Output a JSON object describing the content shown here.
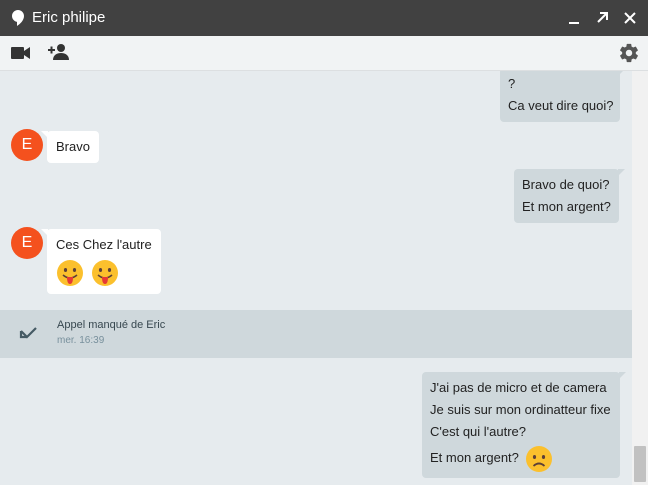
{
  "window": {
    "title": "Eric philipe",
    "icons": [
      "hangouts-bubble-icon",
      "minimize-icon",
      "popout-icon",
      "close-icon"
    ]
  },
  "toolbar": {
    "icons": [
      "video-call-icon",
      "add-person-icon",
      "settings-gear-icon"
    ]
  },
  "contact": {
    "initial": "E",
    "avatar_color": "#f4511e"
  },
  "messages": [
    {
      "from": "me",
      "lines": [
        "?",
        "Ca veut dire quoi?"
      ]
    },
    {
      "from": "them",
      "lines": [
        "Bravo"
      ]
    },
    {
      "from": "me",
      "lines": [
        "Bravo de quoi?",
        "Et mon argent?"
      ]
    },
    {
      "from": "them",
      "lines": [
        "Ces Chez l'autre"
      ],
      "emoji": [
        "tongue-out-emoji",
        "tongue-out-emoji"
      ]
    },
    {
      "from": "me",
      "lines": [
        "J'ai pas de micro et de camera",
        "Je suis sur mon ordinatteur fixe",
        "C'est qui l'autre?",
        "Et mon argent?"
      ],
      "emoji_after_last": "sad-face-emoji"
    }
  ],
  "missed_call": {
    "title": "Appel manqué de Eric",
    "time": "mer. 16:39"
  },
  "colors": {
    "titlebar": "#414141",
    "outgoing_bubble": "#cfd8dc",
    "incoming_bubble": "#ffffff",
    "chat_background": "#e6ebee",
    "avatar": "#f4511e"
  }
}
